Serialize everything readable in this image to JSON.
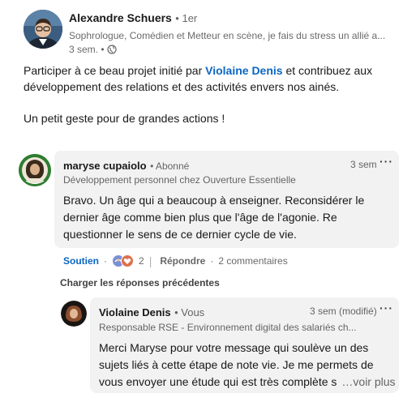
{
  "post": {
    "author": {
      "name": "Alexandre Schuers",
      "degree": "• 1er",
      "headline": "Sophrologue, Comédien et Metteur en scène, je fais du stress un allié a...",
      "time": "3 sem. •"
    },
    "text": {
      "line1_before": "Participer à ce beau projet initié par ",
      "line1_mention": "Violaine Denis",
      "line1_after": " et contribuez aux",
      "line2": "développement des relations et des activités envers nos ainés.",
      "line3": "Un petit geste pour de grandes actions !"
    }
  },
  "comment1": {
    "author": "maryse cupaiolo",
    "relation": "• Abonné",
    "headline": "Développement personnel chez Ouverture Essentielle",
    "time": "3 sem",
    "lines": [
      "Bravo. Un âge qui a beaucoup à enseigner. Reconsidérer le",
      "dernier âge comme bien plus que l'âge de l'agonie. Re",
      "questionner le sens de ce dernier cycle de vie."
    ],
    "actions": {
      "reaction_label": "Soutien",
      "dot1": "·",
      "reaction_count": "2",
      "divider": "|",
      "reply_label": "Répondre",
      "dot2": "·",
      "replies_count": "2 commentaires"
    }
  },
  "load_previous": "Charger les réponses précédentes",
  "reply1": {
    "author": "Violaine Denis",
    "relation": "• Vous",
    "headline": "Responsable RSE - Environnement digital des salariés ch...",
    "time": "3 sem (modifié)",
    "lines": [
      "Merci Maryse pour votre message qui soulève un des",
      "sujets liés à cette étape de note vie. Je me permets de",
      "vous envoyer une étude qui est très complète s"
    ],
    "see_more": "…voir plus"
  },
  "colors": {
    "link": "#0a66c2",
    "comment_bg": "#f2f2f2"
  },
  "icons": [
    "globe-icon",
    "more-options-icon",
    "support-reaction-icon",
    "love-reaction-icon"
  ]
}
